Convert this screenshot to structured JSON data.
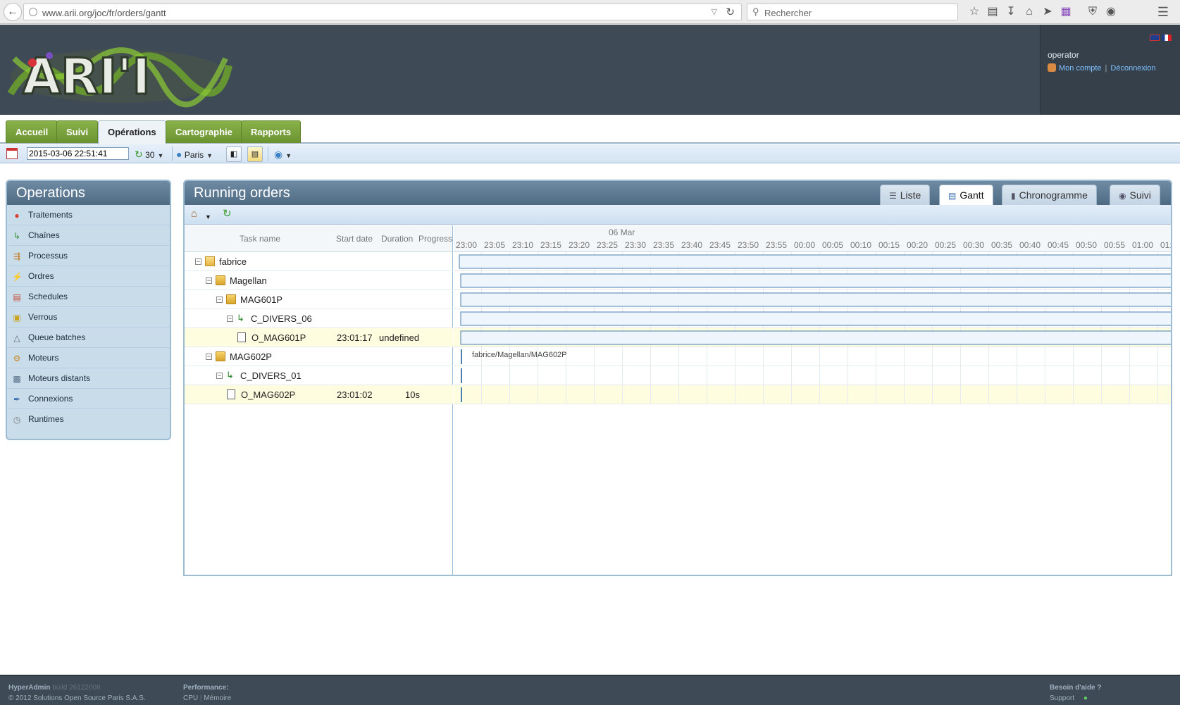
{
  "browser": {
    "url": "www.arii.org/joc/fr/orders/gantt",
    "search_placeholder": "Rechercher"
  },
  "header": {
    "logo_text": "ARI'I",
    "user": "operator",
    "account_link": "Mon compte",
    "logout_link": "Déconnexion",
    "link_separator": "|"
  },
  "tabs": [
    {
      "label": "Accueil",
      "active": false
    },
    {
      "label": "Suivi",
      "active": false
    },
    {
      "label": "Opérations",
      "active": true
    },
    {
      "label": "Cartographie",
      "active": false
    },
    {
      "label": "Rapports",
      "active": false
    }
  ],
  "toolbar": {
    "date": "2015-03-06 22:51:41",
    "refresh": "30",
    "timezone": "Paris"
  },
  "left_panel": {
    "title": "Operations",
    "items": [
      {
        "label": "Traitements",
        "icon": "treatments-icon"
      },
      {
        "label": "Chaînes",
        "icon": "chains-icon"
      },
      {
        "label": "Processus",
        "icon": "process-icon"
      },
      {
        "label": "Ordres",
        "icon": "orders-icon"
      },
      {
        "label": "Schedules",
        "icon": "schedules-icon"
      },
      {
        "label": "Verrous",
        "icon": "lock-icon"
      },
      {
        "label": "Queue batches",
        "icon": "queue-icon"
      },
      {
        "label": "Moteurs",
        "icon": "engine-icon"
      },
      {
        "label": "Moteurs distants",
        "icon": "remote-engine-icon"
      },
      {
        "label": "Connexions",
        "icon": "connection-icon"
      },
      {
        "label": "Runtimes",
        "icon": "runtime-icon"
      }
    ]
  },
  "right_panel": {
    "title": "Running orders",
    "view_tabs": [
      {
        "label": "Liste",
        "active": false
      },
      {
        "label": "Gantt",
        "active": true
      },
      {
        "label": "Chronogramme",
        "active": false
      },
      {
        "label": "Suivi",
        "active": false
      }
    ]
  },
  "gantt": {
    "columns": {
      "task": "Task name",
      "start": "Start date",
      "duration": "Duration",
      "progress": "Progress"
    },
    "scale_date": "06 Mar",
    "scale_labels": [
      "23:00",
      "23:05",
      "23:10",
      "23:15",
      "23:20",
      "23:25",
      "23:30",
      "23:35",
      "23:40",
      "23:45",
      "23:50",
      "23:55",
      "00:00",
      "00:05",
      "00:10",
      "00:15",
      "00:20",
      "00:25",
      "00:30",
      "00:35",
      "00:40",
      "00:45",
      "00:50",
      "00:55",
      "01:00",
      "01:"
    ],
    "rows": [
      {
        "name": "fabrice",
        "level": 0,
        "kind": "spool",
        "toggle": true,
        "start": "",
        "duration": "",
        "bar": "full",
        "selected": false,
        "bar_label": ""
      },
      {
        "name": "Magellan",
        "level": 1,
        "kind": "folder",
        "toggle": true,
        "start": "",
        "duration": "",
        "bar": "full",
        "selected": false,
        "bar_label": ""
      },
      {
        "name": "MAG601P",
        "level": 2,
        "kind": "folder",
        "toggle": true,
        "start": "",
        "duration": "",
        "bar": "full",
        "selected": false,
        "bar_label": ""
      },
      {
        "name": "C_DIVERS_06",
        "level": 3,
        "kind": "chain",
        "toggle": true,
        "start": "",
        "duration": "",
        "bar": "full",
        "selected": false,
        "bar_label": ""
      },
      {
        "name": "O_MAG601P",
        "level": 4,
        "kind": "file",
        "toggle": false,
        "start": "23:01:17",
        "duration": "undefined",
        "bar": "full",
        "selected": true,
        "bar_label": ""
      },
      {
        "name": "MAG602P",
        "level": 1,
        "kind": "folder",
        "toggle": true,
        "start": "",
        "duration": "",
        "bar": "mark",
        "selected": false,
        "bar_label": "fabrice/Magellan/MAG602P"
      },
      {
        "name": "C_DIVERS_01",
        "level": 2,
        "kind": "chain",
        "toggle": true,
        "start": "",
        "duration": "",
        "bar": "mark",
        "selected": false,
        "bar_label": ""
      },
      {
        "name": "O_MAG602P",
        "level": 3,
        "kind": "file",
        "toggle": false,
        "start": "23:01:02",
        "duration": "10s",
        "bar": "mark",
        "selected": true,
        "bar_label": ""
      }
    ]
  },
  "footer": {
    "brand": "HyperAdmin",
    "build": "build 26122008",
    "copyright": "© 2012 Solutions Open Source Paris S.A.S.",
    "perf_title": "Performance:",
    "cpu": "CPU",
    "memory": "Mémoire",
    "help_title": "Besoin d'aide ?",
    "support": "Support"
  },
  "colors": {
    "header_bg": "#3e4a55",
    "tab_green": "#7aa33b",
    "panel_blue": "#c8dcea",
    "bar_fill": "#eef5fc",
    "bar_border": "#4a7fb0",
    "selected_row": "#fffde0"
  }
}
